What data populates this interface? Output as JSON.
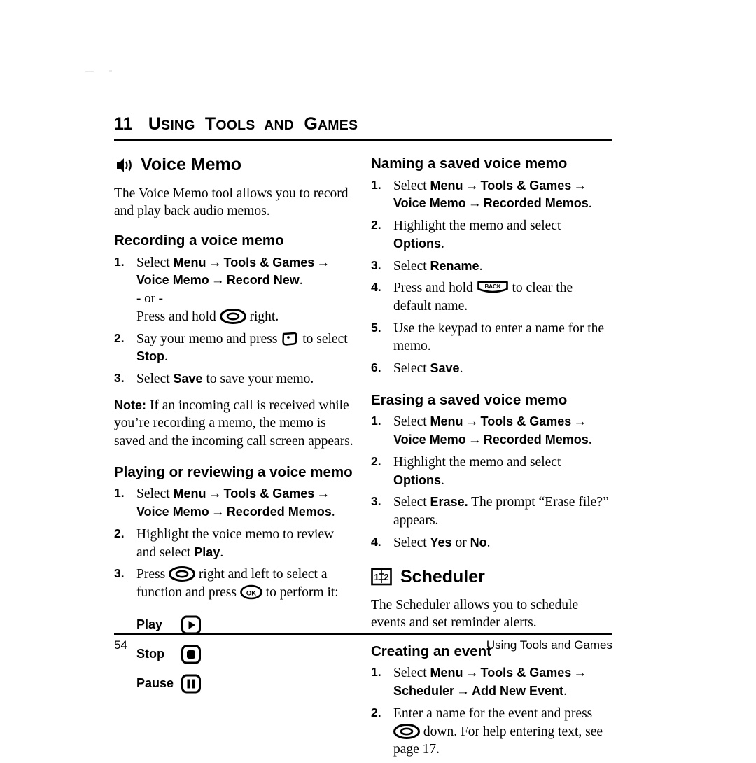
{
  "chapter": {
    "number": "11",
    "title": "Using Tools and Games",
    "title_words": [
      "Using",
      "Tools",
      "and",
      "Games"
    ]
  },
  "footer": {
    "page_number": "54",
    "running_title": "Using Tools and Games"
  },
  "left_column": {
    "section": {
      "icon": "voice-memo-icon",
      "title": "Voice Memo",
      "intro": "The Voice Memo tool allows you to record and play back audio memos."
    },
    "recording": {
      "heading": "Recording a voice memo",
      "steps": [
        {
          "num": "1.",
          "lead": "Select",
          "path_line1": [
            "Menu",
            "Tools & Games"
          ],
          "path_line2": [
            "Voice Memo",
            "Record New"
          ],
          "trailing": ".",
          "or_text": "- or -",
          "alt_prefix": "Press and hold",
          "alt_icon": "nav-key-icon",
          "alt_suffix": "right."
        },
        {
          "num": "2.",
          "prefix": "Say your memo and press",
          "icon": "soft-key-icon",
          "mid": "to select",
          "bold": "Stop",
          "suffix": "."
        },
        {
          "num": "3.",
          "prefix": "Select",
          "bold": "Save",
          "suffix": "to save your memo."
        }
      ],
      "note_label": "Note:",
      "note_text": "If an incoming call is received while you’re recording a memo, the memo is saved and the incoming call screen appears."
    },
    "playing": {
      "heading": "Playing or reviewing a voice memo",
      "steps": [
        {
          "num": "1.",
          "lead": "Select",
          "path_line1": [
            "Menu",
            "Tools & Games"
          ],
          "path_line2": [
            "Voice Memo",
            "Recorded Memos"
          ],
          "trailing": "."
        },
        {
          "num": "2.",
          "prefix": "Highlight the voice memo to review and select",
          "bold": "Play",
          "suffix": "."
        },
        {
          "num": "3.",
          "prefix": "Press",
          "icon": "nav-key-icon",
          "mid": "right and left to select a function and press",
          "icon2": "ok-key-icon",
          "suffix": "to perform it:"
        }
      ],
      "functions": [
        {
          "label": "Play",
          "icon": "play-key-icon"
        },
        {
          "label": "Stop",
          "icon": "stop-key-icon"
        },
        {
          "label": "Pause",
          "icon": "pause-key-icon"
        }
      ]
    }
  },
  "right_column": {
    "naming": {
      "heading": "Naming a saved voice memo",
      "steps": [
        {
          "num": "1.",
          "lead": "Select",
          "path_line1": [
            "Menu",
            "Tools & Games"
          ],
          "path_line2": [
            "Voice Memo",
            "Recorded Memos"
          ],
          "trailing": "."
        },
        {
          "num": "2.",
          "prefix": "Highlight the memo and select",
          "bold": "Options",
          "suffix": "."
        },
        {
          "num": "3.",
          "prefix": "Select",
          "bold": "Rename",
          "suffix": "."
        },
        {
          "num": "4.",
          "prefix": "Press and hold",
          "icon": "back-key-icon",
          "suffix": "to clear the default name."
        },
        {
          "num": "5.",
          "text": "Use the keypad to enter a name for the memo."
        },
        {
          "num": "6.",
          "prefix": "Select",
          "bold": "Save",
          "suffix": "."
        }
      ]
    },
    "erasing": {
      "heading": "Erasing a saved voice memo",
      "steps": [
        {
          "num": "1.",
          "lead": "Select",
          "path_line1": [
            "Menu",
            "Tools & Games"
          ],
          "path_line2": [
            "Voice Memo",
            "Recorded Memos"
          ],
          "trailing": "."
        },
        {
          "num": "2.",
          "prefix": "Highlight the memo and select",
          "bold": "Options",
          "suffix": "."
        },
        {
          "num": "3.",
          "prefix": "Select",
          "bold": "Erase.",
          "suffix": "The prompt “Erase file?” appears."
        },
        {
          "num": "4.",
          "prefix": "Select",
          "bold": "Yes",
          "mid": "or",
          "bold2": "No",
          "suffix": "."
        }
      ]
    },
    "scheduler": {
      "icon": "scheduler-book-icon",
      "title": "Scheduler",
      "intro": "The Scheduler allows you to schedule events and set reminder alerts.",
      "creating": {
        "heading": "Creating an event",
        "steps": [
          {
            "num": "1.",
            "lead": "Select",
            "path_line1": [
              "Menu",
              "Tools & Games"
            ],
            "path_line2": [
              "Scheduler",
              "Add New Event"
            ],
            "trailing": "."
          },
          {
            "num": "2.",
            "prefix": "Enter a name for the event and press",
            "icon": "nav-key-icon",
            "suffix": "down. For help entering text, see page 17."
          }
        ]
      }
    }
  },
  "symbols": {
    "arrow": "→",
    "back_key_label": "BACK",
    "ok_key_label": "OK",
    "scheduler_left_digit": "1",
    "scheduler_right_digit": "2"
  }
}
